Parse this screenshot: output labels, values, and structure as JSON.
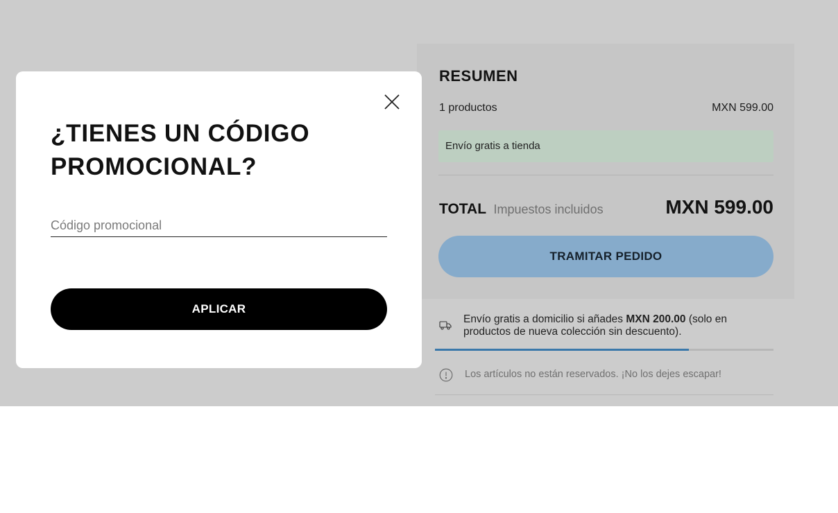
{
  "summary": {
    "title": "RESUMEN",
    "products_label": "1 productos",
    "products_price": "MXN 599.00",
    "shipping_note": "Envío gratis a tienda",
    "total_label": "TOTAL",
    "total_sub": "Impuestos incluidos",
    "total_value": "MXN 599.00",
    "checkout_label": "TRAMITAR PEDIDO"
  },
  "free_shipping": {
    "text_before": "Envío gratis a domicilio si añades ",
    "amount": "MXN 200.00",
    "text_after": " (solo en productos de nueva colección sin descuento).",
    "progress": 0.75
  },
  "notice": {
    "text": "Los artículos no están reservados. ¡No los dejes escapar!"
  },
  "modal": {
    "title": "¿TIENES UN CÓDIGO PROMOCIONAL?",
    "input_placeholder": "Código promocional",
    "input_value": "",
    "apply_label": "APLICAR"
  },
  "icons": {
    "close": "close-icon",
    "truck": "truck-icon",
    "info": "info-icon"
  },
  "colors": {
    "checkout_button": "#86abcb",
    "shipping_note_bg": "#bdcfc1",
    "progress_fill": "#3a78aa",
    "apply_button": "#000000",
    "overlay": "#cccccc"
  }
}
